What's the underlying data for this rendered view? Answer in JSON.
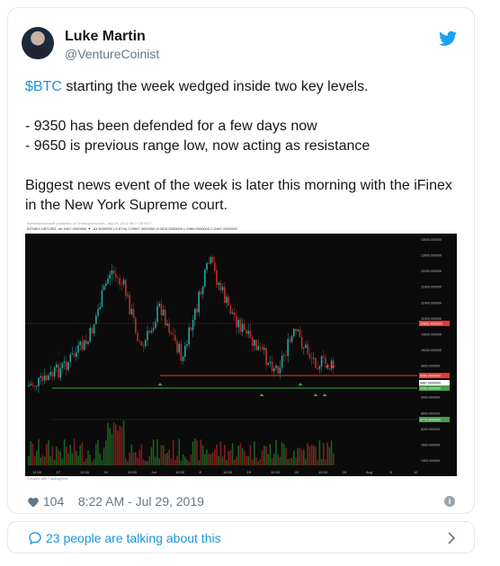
{
  "author": {
    "name": "Luke Martin",
    "handle": "@VentureCoinist"
  },
  "tweet": {
    "cashtag": "$BTC",
    "line1_rest": " starting the week wedged inside two key levels.",
    "line2": "- 9350 has been defended for a few days now",
    "line3": "- 9650 is previous range low, now acting as resistance",
    "line4": "Biggest news event of the week is later this morning with the iFinex",
    "line5": "in the New York Supreme court."
  },
  "chart_image": {
    "meta_line1": "martinlukeschauff published on TradingView.com, July 29, 2019 08:27:28 EDT",
    "meta_line2": "BITMEX:XBTUSD, 4H 9467.0000000 ▼ -63.5000000 (-0.67%) O:9597.0000000 H:9615.5000000 L:9460.0000000 C:9467.0000000",
    "created_with": "Created with TradingView",
    "x_ticks": [
      "12:00",
      "17",
      "12:00",
      "24",
      "12:00",
      "Jul",
      "12:00",
      "8",
      "12:00",
      "15",
      "12:00",
      "22",
      "12:00",
      "29",
      "Aug",
      "5",
      "12"
    ],
    "y_ticks": [
      "13000.000000",
      "12600.000000",
      "12200.000000",
      "11800.000000",
      "11400.000000",
      "11000.000000",
      "10600.000000",
      "10200.000000",
      "9800.000000",
      "9400.000000",
      "9000.000000",
      "8600.000000",
      "8200.000000",
      "7800.000000",
      "7400.000000"
    ],
    "price_labels": [
      {
        "text": "10852.4000000",
        "color": "#e53935"
      },
      {
        "text": "9650.0000000",
        "color": "#e53935"
      },
      {
        "text": "9467.0000000",
        "color": "#ffffff"
      },
      {
        "text": "9350.0000000",
        "color": "#43a047"
      },
      {
        "text": "8775.0000000",
        "color": "#43a047"
      }
    ],
    "colors": {
      "background": "#0b0b0b",
      "up": "#26a69a",
      "down": "#c62828",
      "resistance": "#e53935",
      "support": "#43a047",
      "volume_up": "#1b5e20",
      "volume_down": "#7f1d1d"
    }
  },
  "stats": {
    "likes": "104",
    "timestamp": "8:22 AM - Jul 29, 2019"
  },
  "footer": {
    "label": "23 people are talking about this"
  },
  "icons": {
    "twitter_bird": "bird-icon",
    "heart": "heart-icon",
    "info": "info-icon",
    "comment": "comment-bubble-icon",
    "chevron": "chevron-right-icon"
  }
}
